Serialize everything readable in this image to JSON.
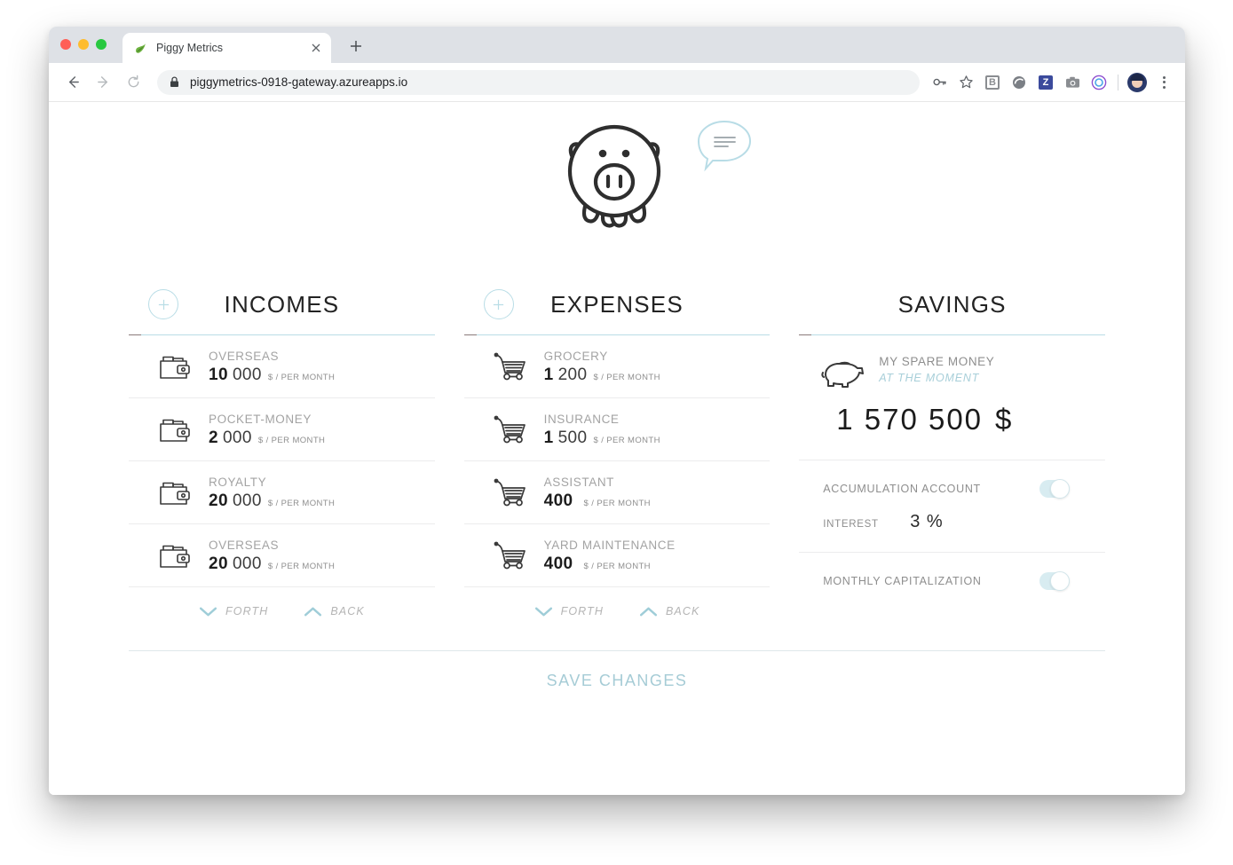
{
  "browser": {
    "tab_title": "Piggy Metrics",
    "tab_favicon": "spring-leaf-icon",
    "close_tab": "×",
    "new_tab": "+",
    "back": "←",
    "forward": "→",
    "reload": "↻",
    "url": "piggymetrics-0918-gateway.azureapps.io",
    "lock_icon": "lock-icon",
    "extensions": [
      {
        "name": "password-key-icon",
        "glyph": "⚷"
      },
      {
        "name": "bookmark-star-icon",
        "glyph": "☆"
      },
      {
        "name": "b-extension-icon",
        "glyph": "B"
      },
      {
        "name": "circle-extension-icon",
        "glyph": "●"
      },
      {
        "name": "z-extension-icon",
        "glyph": "Z"
      },
      {
        "name": "camera-extension-icon",
        "glyph": "■"
      },
      {
        "name": "target-extension-icon",
        "glyph": "◎"
      }
    ],
    "profile": "profile-avatar",
    "menu": "chrome-menu-icon"
  },
  "app": {
    "logo": "piggy-bank-logo",
    "chat_bubble": "message-bubble-icon"
  },
  "incomes": {
    "title": "INCOMES",
    "add_label": "+",
    "items": [
      {
        "title": "OVERSEAS",
        "amount_bold": "10",
        "amount_light": "000",
        "unit": "$ / PER MONTH",
        "icon": "wallet-icon"
      },
      {
        "title": "POCKET-MONEY",
        "amount_bold": "2",
        "amount_light": "000",
        "unit": "$ / PER MONTH",
        "icon": "wallet-icon"
      },
      {
        "title": "ROYALTY",
        "amount_bold": "20",
        "amount_light": "000",
        "unit": "$ / PER MONTH",
        "icon": "wallet-icon"
      },
      {
        "title": "OVERSEAS",
        "amount_bold": "20",
        "amount_light": "000",
        "unit": "$ / PER MONTH",
        "icon": "wallet-icon"
      }
    ],
    "forth_label": "FORTH",
    "back_label": "BACK"
  },
  "expenses": {
    "title": "EXPENSES",
    "add_label": "+",
    "items": [
      {
        "title": "GROCERY",
        "amount_bold": "1",
        "amount_light": "200",
        "unit": "$ / PER MONTH",
        "icon": "shopping-cart-icon"
      },
      {
        "title": "INSURANCE",
        "amount_bold": "1",
        "amount_light": "500",
        "unit": "$ / PER MONTH",
        "icon": "shopping-cart-icon"
      },
      {
        "title": "ASSISTANT",
        "amount_bold": "400",
        "amount_light": "",
        "unit": "$ / PER MONTH",
        "icon": "shopping-cart-icon"
      },
      {
        "title": "YARD MAINTENANCE",
        "amount_bold": "400",
        "amount_light": "",
        "unit": "$ / PER MONTH",
        "icon": "shopping-cart-icon"
      }
    ],
    "forth_label": "FORTH",
    "back_label": "BACK"
  },
  "savings": {
    "title": "SAVINGS",
    "icon": "piggy-bank-side-icon",
    "name": "MY SPARE MONEY",
    "subtitle": "AT THE MOMENT",
    "amount": "1 570 500",
    "currency": "$",
    "accumulation_label": "ACCUMULATION ACCOUNT",
    "accumulation_on": true,
    "interest_label": "INTEREST",
    "interest_value": "3 %",
    "capitalization_label": "MONTHLY CAPITALIZATION",
    "capitalization_on": true
  },
  "footer": {
    "save_label": "SAVE CHANGES"
  },
  "colors": {
    "accent_blue": "#a6ccd6",
    "rule_blue": "#b9dde6",
    "text_dark": "#1d1d1d",
    "text_muted": "#a3a3a3"
  }
}
